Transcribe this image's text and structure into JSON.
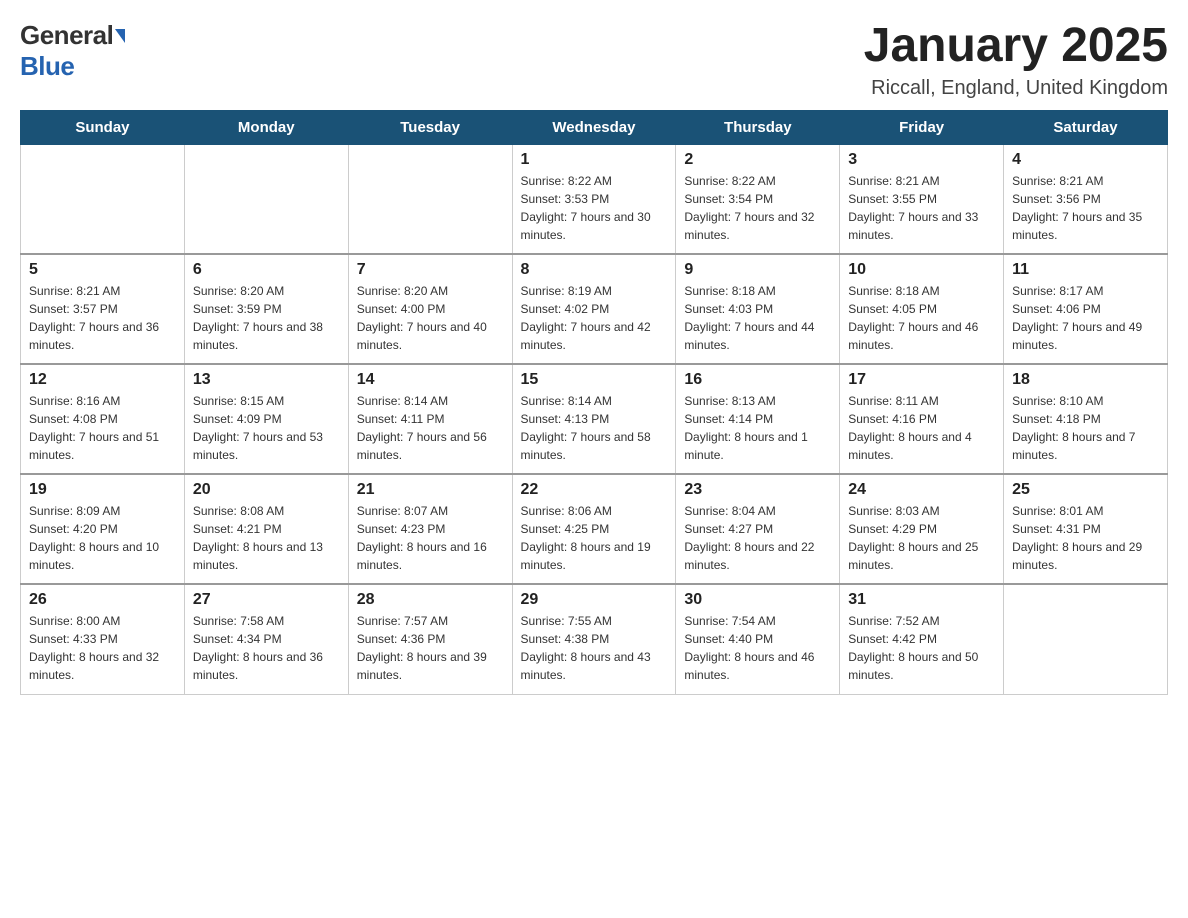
{
  "header": {
    "logo_general": "General",
    "logo_blue": "Blue",
    "title": "January 2025",
    "subtitle": "Riccall, England, United Kingdom"
  },
  "days_of_week": [
    "Sunday",
    "Monday",
    "Tuesday",
    "Wednesday",
    "Thursday",
    "Friday",
    "Saturday"
  ],
  "weeks": [
    [
      {
        "day": "",
        "sunrise": "",
        "sunset": "",
        "daylight": ""
      },
      {
        "day": "",
        "sunrise": "",
        "sunset": "",
        "daylight": ""
      },
      {
        "day": "",
        "sunrise": "",
        "sunset": "",
        "daylight": ""
      },
      {
        "day": "1",
        "sunrise": "Sunrise: 8:22 AM",
        "sunset": "Sunset: 3:53 PM",
        "daylight": "Daylight: 7 hours and 30 minutes."
      },
      {
        "day": "2",
        "sunrise": "Sunrise: 8:22 AM",
        "sunset": "Sunset: 3:54 PM",
        "daylight": "Daylight: 7 hours and 32 minutes."
      },
      {
        "day": "3",
        "sunrise": "Sunrise: 8:21 AM",
        "sunset": "Sunset: 3:55 PM",
        "daylight": "Daylight: 7 hours and 33 minutes."
      },
      {
        "day": "4",
        "sunrise": "Sunrise: 8:21 AM",
        "sunset": "Sunset: 3:56 PM",
        "daylight": "Daylight: 7 hours and 35 minutes."
      }
    ],
    [
      {
        "day": "5",
        "sunrise": "Sunrise: 8:21 AM",
        "sunset": "Sunset: 3:57 PM",
        "daylight": "Daylight: 7 hours and 36 minutes."
      },
      {
        "day": "6",
        "sunrise": "Sunrise: 8:20 AM",
        "sunset": "Sunset: 3:59 PM",
        "daylight": "Daylight: 7 hours and 38 minutes."
      },
      {
        "day": "7",
        "sunrise": "Sunrise: 8:20 AM",
        "sunset": "Sunset: 4:00 PM",
        "daylight": "Daylight: 7 hours and 40 minutes."
      },
      {
        "day": "8",
        "sunrise": "Sunrise: 8:19 AM",
        "sunset": "Sunset: 4:02 PM",
        "daylight": "Daylight: 7 hours and 42 minutes."
      },
      {
        "day": "9",
        "sunrise": "Sunrise: 8:18 AM",
        "sunset": "Sunset: 4:03 PM",
        "daylight": "Daylight: 7 hours and 44 minutes."
      },
      {
        "day": "10",
        "sunrise": "Sunrise: 8:18 AM",
        "sunset": "Sunset: 4:05 PM",
        "daylight": "Daylight: 7 hours and 46 minutes."
      },
      {
        "day": "11",
        "sunrise": "Sunrise: 8:17 AM",
        "sunset": "Sunset: 4:06 PM",
        "daylight": "Daylight: 7 hours and 49 minutes."
      }
    ],
    [
      {
        "day": "12",
        "sunrise": "Sunrise: 8:16 AM",
        "sunset": "Sunset: 4:08 PM",
        "daylight": "Daylight: 7 hours and 51 minutes."
      },
      {
        "day": "13",
        "sunrise": "Sunrise: 8:15 AM",
        "sunset": "Sunset: 4:09 PM",
        "daylight": "Daylight: 7 hours and 53 minutes."
      },
      {
        "day": "14",
        "sunrise": "Sunrise: 8:14 AM",
        "sunset": "Sunset: 4:11 PM",
        "daylight": "Daylight: 7 hours and 56 minutes."
      },
      {
        "day": "15",
        "sunrise": "Sunrise: 8:14 AM",
        "sunset": "Sunset: 4:13 PM",
        "daylight": "Daylight: 7 hours and 58 minutes."
      },
      {
        "day": "16",
        "sunrise": "Sunrise: 8:13 AM",
        "sunset": "Sunset: 4:14 PM",
        "daylight": "Daylight: 8 hours and 1 minute."
      },
      {
        "day": "17",
        "sunrise": "Sunrise: 8:11 AM",
        "sunset": "Sunset: 4:16 PM",
        "daylight": "Daylight: 8 hours and 4 minutes."
      },
      {
        "day": "18",
        "sunrise": "Sunrise: 8:10 AM",
        "sunset": "Sunset: 4:18 PM",
        "daylight": "Daylight: 8 hours and 7 minutes."
      }
    ],
    [
      {
        "day": "19",
        "sunrise": "Sunrise: 8:09 AM",
        "sunset": "Sunset: 4:20 PM",
        "daylight": "Daylight: 8 hours and 10 minutes."
      },
      {
        "day": "20",
        "sunrise": "Sunrise: 8:08 AM",
        "sunset": "Sunset: 4:21 PM",
        "daylight": "Daylight: 8 hours and 13 minutes."
      },
      {
        "day": "21",
        "sunrise": "Sunrise: 8:07 AM",
        "sunset": "Sunset: 4:23 PM",
        "daylight": "Daylight: 8 hours and 16 minutes."
      },
      {
        "day": "22",
        "sunrise": "Sunrise: 8:06 AM",
        "sunset": "Sunset: 4:25 PM",
        "daylight": "Daylight: 8 hours and 19 minutes."
      },
      {
        "day": "23",
        "sunrise": "Sunrise: 8:04 AM",
        "sunset": "Sunset: 4:27 PM",
        "daylight": "Daylight: 8 hours and 22 minutes."
      },
      {
        "day": "24",
        "sunrise": "Sunrise: 8:03 AM",
        "sunset": "Sunset: 4:29 PM",
        "daylight": "Daylight: 8 hours and 25 minutes."
      },
      {
        "day": "25",
        "sunrise": "Sunrise: 8:01 AM",
        "sunset": "Sunset: 4:31 PM",
        "daylight": "Daylight: 8 hours and 29 minutes."
      }
    ],
    [
      {
        "day": "26",
        "sunrise": "Sunrise: 8:00 AM",
        "sunset": "Sunset: 4:33 PM",
        "daylight": "Daylight: 8 hours and 32 minutes."
      },
      {
        "day": "27",
        "sunrise": "Sunrise: 7:58 AM",
        "sunset": "Sunset: 4:34 PM",
        "daylight": "Daylight: 8 hours and 36 minutes."
      },
      {
        "day": "28",
        "sunrise": "Sunrise: 7:57 AM",
        "sunset": "Sunset: 4:36 PM",
        "daylight": "Daylight: 8 hours and 39 minutes."
      },
      {
        "day": "29",
        "sunrise": "Sunrise: 7:55 AM",
        "sunset": "Sunset: 4:38 PM",
        "daylight": "Daylight: 8 hours and 43 minutes."
      },
      {
        "day": "30",
        "sunrise": "Sunrise: 7:54 AM",
        "sunset": "Sunset: 4:40 PM",
        "daylight": "Daylight: 8 hours and 46 minutes."
      },
      {
        "day": "31",
        "sunrise": "Sunrise: 7:52 AM",
        "sunset": "Sunset: 4:42 PM",
        "daylight": "Daylight: 8 hours and 50 minutes."
      },
      {
        "day": "",
        "sunrise": "",
        "sunset": "",
        "daylight": ""
      }
    ]
  ]
}
